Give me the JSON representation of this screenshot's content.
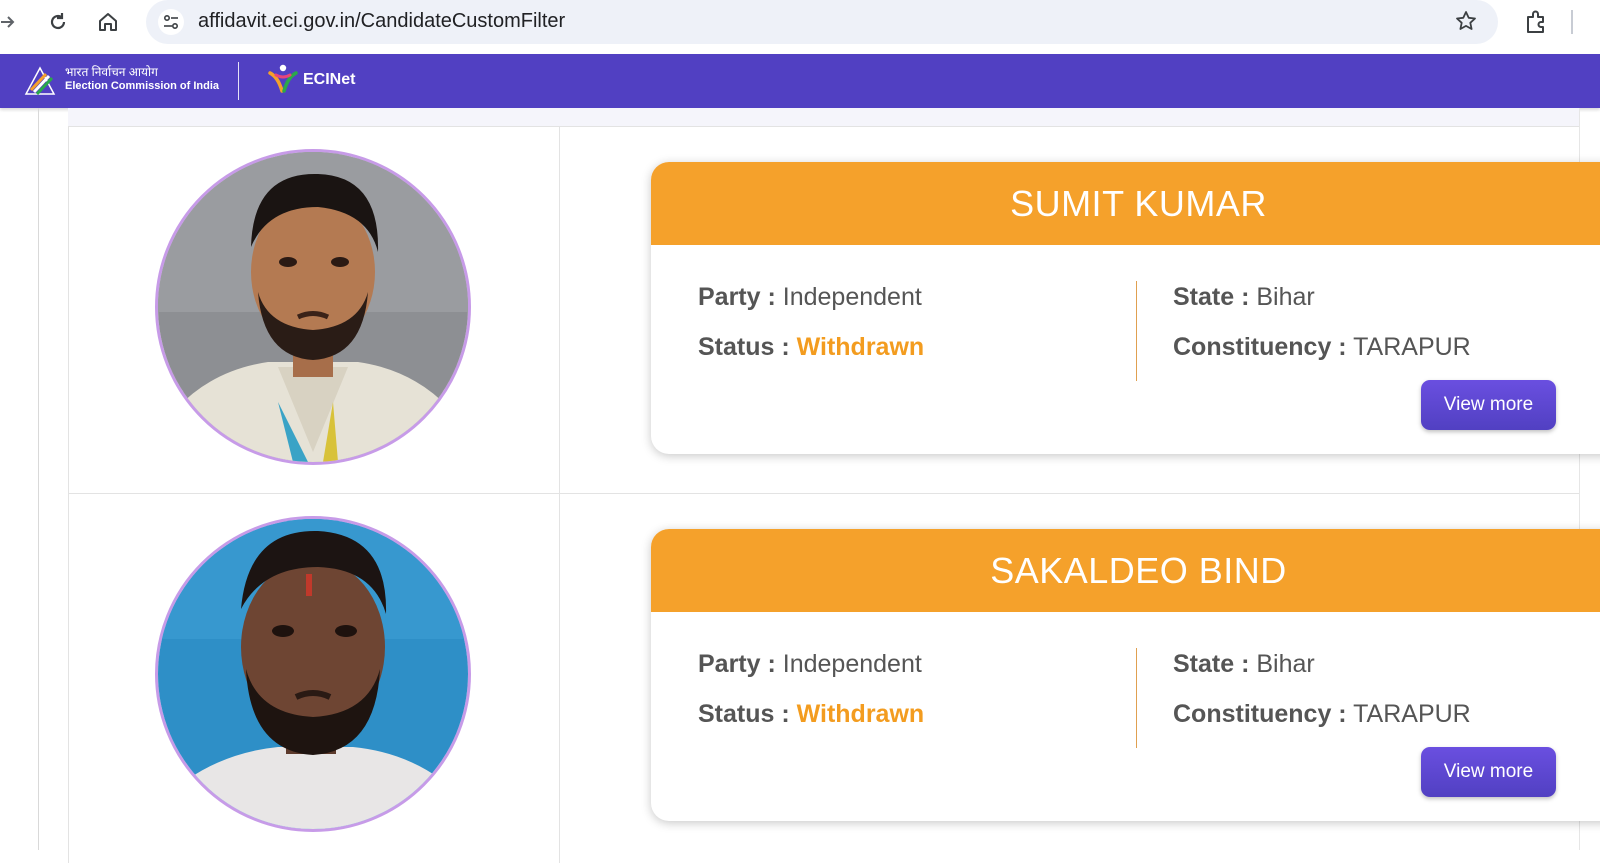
{
  "browser": {
    "url": "affidavit.eci.gov.in/CandidateCustomFilter"
  },
  "header": {
    "org_hindi": "भारत निर्वाचन आयोग",
    "org_english": "Election Commission of India",
    "app_name": "ECINet",
    "color": "#5140c2"
  },
  "candidates": [
    {
      "name": "SUMIT KUMAR",
      "party_label": "Party :",
      "party": "Independent",
      "status_label": "Status :",
      "status": "Withdrawn",
      "state_label": "State :",
      "state": "Bihar",
      "constituency_label": "Constituency :",
      "constituency": "TARAPUR",
      "button": "View more"
    },
    {
      "name": "SAKALDEO BIND",
      "party_label": "Party :",
      "party": "Independent",
      "status_label": "Status :",
      "status": "Withdrawn",
      "state_label": "State :",
      "state": "Bihar",
      "constituency_label": "Constituency :",
      "constituency": "TARAPUR",
      "button": "View more"
    }
  ],
  "colors": {
    "card_header": "#f5a12b",
    "status_withdrawn": "#f39c1f",
    "button": "#5140c2"
  }
}
